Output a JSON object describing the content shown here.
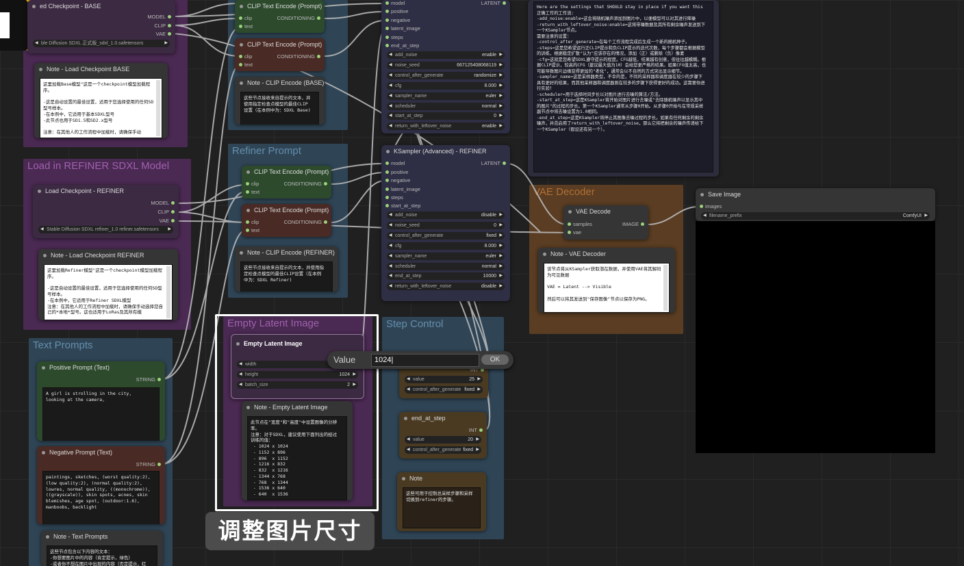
{
  "groups": {
    "base": {
      "title": ""
    },
    "refiner_model": {
      "title": "Load in REFINER SDXL Model"
    },
    "refiner_prompt": {
      "title": "Refiner Prompt"
    },
    "text_prompts": {
      "title": "Text Prompts"
    },
    "empty_latent": {
      "title": "Empty Latent Image"
    },
    "step_control": {
      "title": "Step Control"
    },
    "vae_decoder": {
      "title": "VAE Decoder"
    }
  },
  "nodes": {
    "ckpt_base": {
      "title": "ed Checkpoint - BASE",
      "outputs": [
        "MODEL",
        "CLIP",
        "VAE"
      ],
      "widget": "ble Diffusion SDXL 正式版_sdxl_1.0.safetensors"
    },
    "note_ckpt_base": {
      "title": "Note - Load Checkpoint BASE",
      "text": "这里加载Base模型\"这是一个checkpoint模型加载程序。\n\n-这是自动设置的最佳设置，适用于您选择使用的任何SD型号样本。\n-在本例中，它适用于基本SDXL型号\n-此节点也用于SD1.5和SD2.x型号\n\n注意：在其他人的工作流程中加载时，请确保手动"
    },
    "clip_base_pos": {
      "title": "CLIP Text Encode (Prompt)",
      "in": [
        "clip",
        "text"
      ],
      "out": "CONDITIONING"
    },
    "clip_base_neg": {
      "title": "CLIP Text Encode (Prompt)",
      "in": [
        "clip",
        "text"
      ],
      "out": "CONDITIONING"
    },
    "note_clip_base": {
      "title": "Note - CLIP Encode (BASE)",
      "text": "这些节点接收来自提示的文本，并使用指定检查点模型的最佳CLIP设置（在本例中为：SDXL Base)"
    },
    "ks_base": {
      "inputs": [
        "model",
        "positive",
        "negative",
        "latent_image",
        "steps",
        "end_at_step"
      ],
      "out": "LATENT",
      "widgets": [
        [
          "add_noise",
          "enable"
        ],
        [
          "noise_seed",
          "667125408068119"
        ],
        [
          "control_after_generate",
          "randomize"
        ],
        [
          "cfg",
          "8.000"
        ],
        [
          "sampler_name",
          "euler"
        ],
        [
          "scheduler",
          "normal"
        ],
        [
          "start_at_step",
          "0"
        ],
        [
          "return_with_leftover_noise",
          "enable"
        ]
      ]
    },
    "note_big": {
      "text": "Here are the settings that SHOULD stay in place if you want this 正确工作的工作流:\n-add_noise:enable=这会将随机噪声添加到图片中，以便模型可以对其进行降噪\n-return_with_leftover_noise:enable=这将带噪数据及其所有剩余噪声发送到下一个KSampler节点。\n需要注意的设置：\n-control_after_generate=在每个工作流程完成后生成一个新的随机种子。\n-steps=这是您希望运行正CLIP提示和负CLIP提示的迭代次数，每个步骤都会根据模型的训练，根据稳定扩散\"认为\"应该存在的情况，添加（正）或删除（负）像素\n-cfg=这就是您希望SDXL遵守提示的程度。CFG越低，结果越有创意，但往往越模糊。根据CLIP提示，较高的CFG（建议最大值为10）会给您更严格的结果。如果CFG值太高，也可能导致图片边缘变得更加的\"老化\"，通常会以不自然的方式突出显示细节。\n-sampler_name=这是采样器类型，不幸的是，不同的采样器和调度器在较少的步骤下具有更好的结果，而其他采样器和调度器则在较多的步骤下获得更好的成功。这需要你进行实验！\n-scheduler=用于选择时间步长以对图片进行去噪的算法/方法。\n-start_at_step=这是KSampler将开始对图片进行去噪或\"去除随机噪声以显示其中的图片\"的过程的步长。第一个KSampler通常从步骤0开始。从步骤0开始与在常规采样器节点中将去噪设置为1.0相同。\n-end_at_step=这是KSampler将停止其图像去噪过程的步长。如果有任何剩余的剩余噪声，并且启用了return_with_leftover_noise，那么它将把剩余的噪声传递给下一个KSampler（假设还有另一个）。"
    },
    "ckpt_ref": {
      "title": "Load Checkpoint - REFINER",
      "outputs": [
        "MODEL",
        "CLIP",
        "VAE"
      ],
      "widget": "Stable Diffusion SDXL refiner_1.0 refiner.safetensors"
    },
    "note_ckpt_ref": {
      "title": "Note - Load Checkpoint REFINER",
      "text": "这里加载Refiner模型\"这是一个checkpoint模型加载程序。\n\n-这是自动设置的最佳设置，适用于您选择使用的任何SD型号样本。\n-在本例中，它适用于Refiner SDXL模型\n注意：在其他人的工作流程中加载时，请确保手动选择您自己的*本地*型号。这也适用于LoRas及其所有模"
    },
    "clip_ref_pos": {
      "title": "CLIP Text Encode (Prompt)",
      "in": [
        "clip",
        "text"
      ],
      "out": "CONDITIONING"
    },
    "clip_ref_neg": {
      "title": "CLIP Text Encode (Prompt)",
      "in": [
        "clip",
        "text"
      ],
      "out": "CONDITIONING"
    },
    "note_clip_ref": {
      "title": "Note - CLIP Encode (REFINER)",
      "text": "这些节点接收来自提示的文本，并使用指定检查点模型的最佳CLIP设置（在本例中为：SDXL Refiner)"
    },
    "ks_ref": {
      "title": "KSampler (Advanced) - REFINER",
      "inputs": [
        "model",
        "positive",
        "negative",
        "latent_image",
        "steps",
        "start_at_step"
      ],
      "out": "LATENT",
      "widgets": [
        [
          "add_noise",
          "disable"
        ],
        [
          "noise_seed",
          "0"
        ],
        [
          "control_after_generate",
          "fixed"
        ],
        [
          "cfg",
          "8.000"
        ],
        [
          "sampler_name",
          "euler"
        ],
        [
          "scheduler",
          "normal"
        ],
        [
          "end_at_step",
          "10000"
        ],
        [
          "return_with_leftover_noise",
          "disable"
        ]
      ]
    },
    "vae_decode": {
      "title": "VAE Decode",
      "in": [
        "samples",
        "vae"
      ],
      "out": "IMAGE"
    },
    "note_vae": {
      "title": "Note - VAE Decoder",
      "text": "该节点将从KSampler获取潜在数据，并使用VAE将其解码为可见数据\n\nVAE = Latent --> Visible\n\n然后可以将其发送到\"保存图像\"节点以保存为PNG。"
    },
    "save_image": {
      "title": "Save Image",
      "in": "images",
      "widget_label": "filename_prefix",
      "widget_value": "ComfyUI"
    },
    "positive": {
      "title": "Positive Prompt (Text)",
      "out": "STRING",
      "text": "A girl is strolling in the city, looking at the camera,"
    },
    "negative": {
      "title": "Negative Prompt (Text)",
      "out": "STRING",
      "text": "paintings, sketches, (worst quality:2), (low quality:2), (normal quality:2), lowres, normal quality, ((monochrome)), ((grayscale)), skin spots, acnes, skin blemishes, age spot, (outdoor:1.6), manboobs, backlight"
    },
    "note_text": {
      "title": "Note - Text Prompts",
      "text": "这些节点包含以下内容的文本：\n-你想要图片中的内容（肯定提示，绿色）\n-或者你不想在图片中出现的内容（否定提示，红"
    },
    "empty_latent": {
      "title": "Empty Latent Image",
      "widgets": [
        [
          "width",
          "1024"
        ],
        [
          "height",
          "1024"
        ],
        [
          "batch_size",
          "2"
        ]
      ]
    },
    "note_latent": {
      "title": "Note - Empty Latent Image",
      "text": "此节点在\"宽度\"和\"高度\"中设置图像的分辨率。\n注意：对于SDXL，建议使用下面列出的经过训练的值：\n - 1024 x 1024\n - 1152 x 896\n - 896  x 1152\n - 1216 x 832\n - 832  x 1216\n - 1344 x 768\n - 768  x 1344\n - 1536 x 640\n - 640  x 1536"
    },
    "steps_node": {
      "out": "INT",
      "widgets": [
        [
          "value",
          "25"
        ],
        [
          "control_after_generate",
          "fixed"
        ]
      ]
    },
    "end_step": {
      "title": "end_at_step",
      "out": "INT",
      "widgets": [
        [
          "value",
          "20"
        ],
        [
          "control_after_generate",
          "fixed"
        ]
      ]
    },
    "note_step": {
      "title": "Note",
      "text": "这些可用于控制总采样步骤和采样切换到refiner的步骤。"
    }
  },
  "dialog": {
    "label": "Value",
    "value": "1024",
    "ok": "OK"
  },
  "subtitle": "调整图片尺寸",
  "colors": {
    "purple": "#4e2a55",
    "blue": "#2f4656",
    "orange": "#6b4a2a",
    "green": "#2f4a2f",
    "red": "#4a2a24",
    "wire": "#b8b8b8"
  }
}
